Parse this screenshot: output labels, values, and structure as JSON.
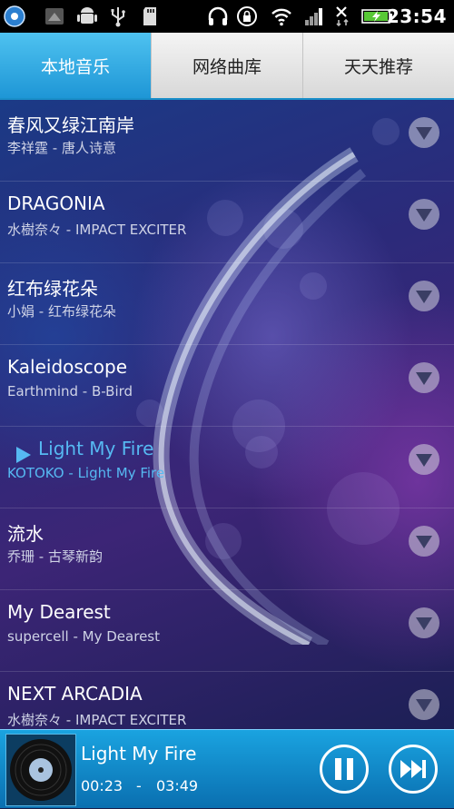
{
  "status_bar": {
    "time": "23:54",
    "icons": [
      "app-icon",
      "notification-icon",
      "android-debug-icon",
      "usb-icon",
      "sd-card-icon",
      "headset-icon",
      "rotation-lock-icon",
      "wifi-icon",
      "signal-icon",
      "no-data-icon",
      "battery-charging-icon"
    ]
  },
  "tabs": [
    {
      "label": "本地音乐",
      "active": true
    },
    {
      "label": "网络曲库",
      "active": false
    },
    {
      "label": "天天推荐",
      "active": false
    }
  ],
  "songs": [
    {
      "title": "春风又绿江南岸",
      "subtitle": "李祥霆 - 唐人诗意"
    },
    {
      "title": "DRAGONIA",
      "subtitle": "水樹奈々 - IMPACT EXCITER"
    },
    {
      "title": "红布绿花朵",
      "subtitle": "小娟 - 红布绿花朵"
    },
    {
      "title": "Kaleidoscope",
      "subtitle": "Earthmind - B-Bird"
    },
    {
      "title": "Light My Fire",
      "subtitle": "KOTOKO - Light My Fire",
      "playing": true
    },
    {
      "title": "流水",
      "subtitle": "乔珊 - 古琴新韵"
    },
    {
      "title": "My Dearest",
      "subtitle": "supercell - My Dearest"
    },
    {
      "title": "NEXT ARCADIA",
      "subtitle": "水樹奈々 - IMPACT EXCITER"
    }
  ],
  "player": {
    "title": "Light My Fire",
    "elapsed": "00:23",
    "separator": "-",
    "duration": "03:49"
  },
  "colors": {
    "accent": "#1e96d6",
    "playing_text": "#56b9f2"
  }
}
